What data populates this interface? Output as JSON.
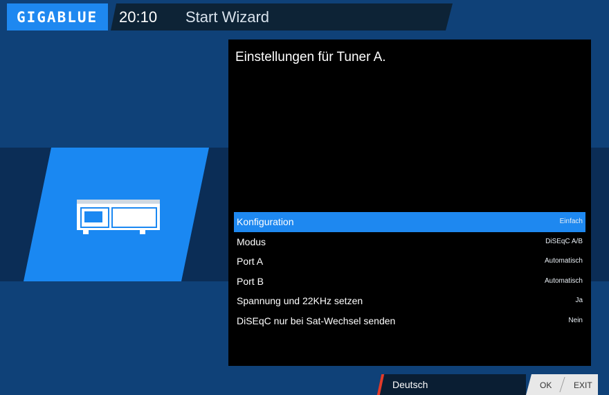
{
  "header": {
    "logo_text": "GIGABLUE",
    "clock": "20:10",
    "title": "Start Wizard"
  },
  "panel": {
    "title": "Einstellungen für Tuner A.",
    "items": [
      {
        "label": "Konfiguration",
        "value": "Einfach"
      },
      {
        "label": "Modus",
        "value": "DiSEqC A/B"
      },
      {
        "label": "Port A",
        "value": "Automatisch"
      },
      {
        "label": "Port B",
        "value": "Automatisch"
      },
      {
        "label": "Spannung und 22KHz setzen",
        "value": "Ja"
      },
      {
        "label": "DiSEqC nur bei Sat-Wechsel senden",
        "value": "Nein"
      }
    ],
    "selected_index": 0
  },
  "footer": {
    "language": "Deutsch",
    "ok_label": "OK",
    "exit_label": "EXIT"
  },
  "icons": {
    "tile_icon": "set-top-box-icon"
  },
  "colors": {
    "accent": "#1e88f0",
    "background": "#0f4178",
    "panel": "#000000",
    "language_accent": "#e23b2a"
  }
}
